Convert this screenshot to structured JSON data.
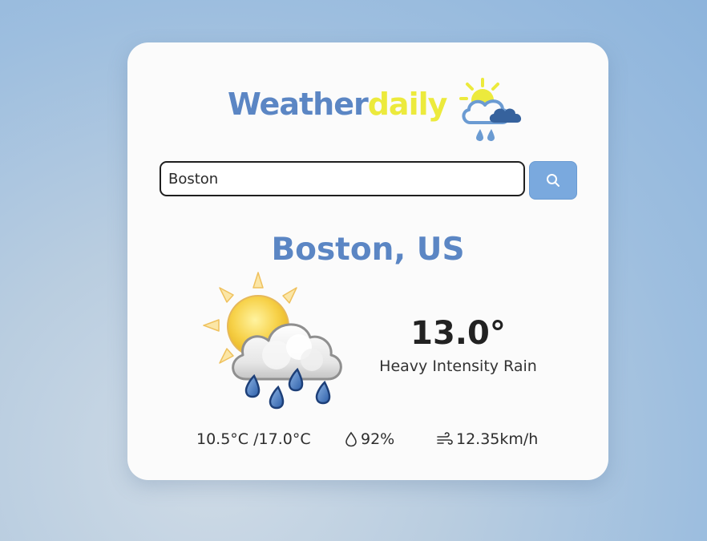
{
  "brand": {
    "part1": "Weather",
    "part2": "daily",
    "logo_icon": "sun-cloud-rain-icon"
  },
  "search": {
    "value": "Boston",
    "button_icon": "search-icon"
  },
  "current": {
    "location": "Boston, US",
    "temperature": "13.0°",
    "description": "Heavy Intensity Rain",
    "condition_icon": "sun-cloud-heavy-rain-icon",
    "min_max": "10.5°C /17.0°C",
    "humidity": "92%",
    "humidity_icon": "droplet-icon",
    "wind": "12.35km/h",
    "wind_icon": "wind-icon"
  },
  "colors": {
    "brand_blue": "#5b86c4",
    "brand_yellow": "#ecea3c",
    "button": "#7aa9de"
  }
}
